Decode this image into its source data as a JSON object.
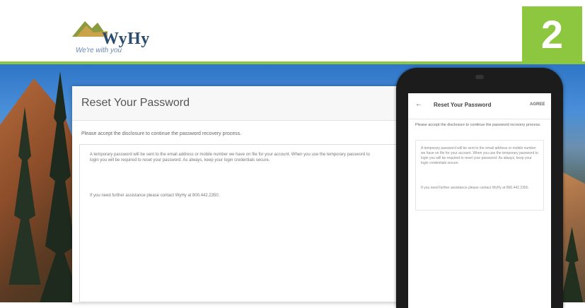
{
  "header": {
    "logo_text": "WyHy",
    "tagline": "We're with you",
    "step_number": "2"
  },
  "desktop": {
    "title": "Reset Your Password",
    "instruction": "Please accept the disclosure to continue the password recovery process.",
    "disclosure": "A temporary password will be sent to the email address or mobile number we have on file for your account. When you use the temporary password to login you will be required to reset your password. As always, keep your login credentials secure.",
    "assistance": "If you need further assistance please contact WyHy at 800.442.2350."
  },
  "phone": {
    "back_icon": "arrow-left-icon",
    "title": "Reset Your Password",
    "agree_label": "AGREE",
    "instruction": "Please accept the disclosure to continue the password recovery process.",
    "disclosure": "A temporary password will be sent to the email address or mobile number we have on file for your account. When you use the temporary password to login you will be required to reset your password. As always, keep your login credentials secure.",
    "assistance": "If you need further assistance please contact WyHy at 800.442.2350."
  },
  "colors": {
    "accent_green": "#8dc63f",
    "brand_blue": "#2b4b6f"
  }
}
